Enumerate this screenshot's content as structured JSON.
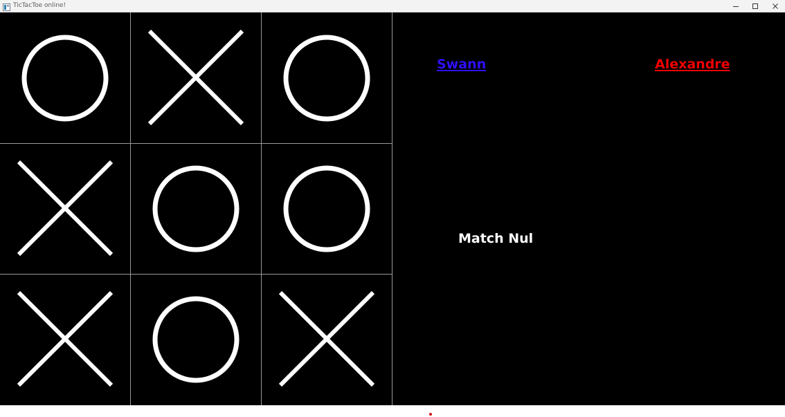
{
  "window": {
    "title": "TicTacToe online!",
    "app_icon": "window-app-icon",
    "buttons": [
      "minimize-icon",
      "maximize-icon",
      "close-icon"
    ]
  },
  "board": {
    "cells": [
      "O",
      "X",
      "O",
      "X",
      "O",
      "O",
      "X",
      "O",
      "X"
    ],
    "mark_color": "#ffffff",
    "background": "#000000",
    "grid_color": "#9a9a9a"
  },
  "players": {
    "player1": {
      "name": "Swann",
      "color": "#2f10ff"
    },
    "player2": {
      "name": "Alexandre",
      "color": "#f00000"
    }
  },
  "status": {
    "result": "Match Nul"
  },
  "colors": {
    "titlebar": "#f3f3f3",
    "status_dot": "#d01010"
  }
}
